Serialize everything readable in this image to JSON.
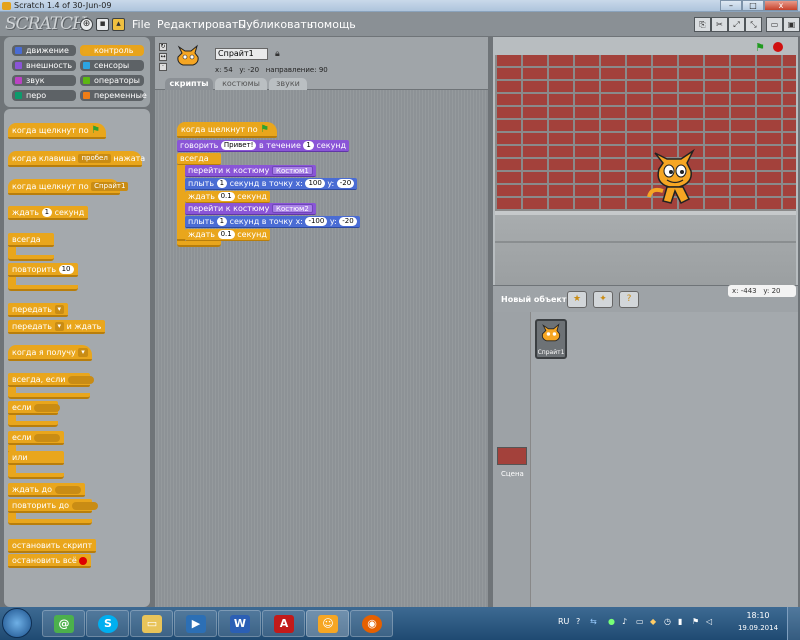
{
  "window": {
    "title": "Scratch 1.4 of 30-Jun-09",
    "minimize": "–",
    "maximize": "□",
    "close": "x"
  },
  "menubar": {
    "logo": "SCRATCH",
    "items": [
      "File",
      "Редактировать",
      "Публиковать",
      "помощь"
    ]
  },
  "categories": [
    {
      "label": "движение",
      "color": "#4a6cd4"
    },
    {
      "label": "контроль",
      "color": "#e9a61c",
      "selected": true
    },
    {
      "label": "внешность",
      "color": "#8a55d7"
    },
    {
      "label": "сенсоры",
      "color": "#2ca5e2"
    },
    {
      "label": "звук",
      "color": "#bb42c3"
    },
    {
      "label": "операторы",
      "color": "#5cb712"
    },
    {
      "label": "перо",
      "color": "#0e9a6c"
    },
    {
      "label": "переменные",
      "color": "#ee7d16"
    }
  ],
  "palette": {
    "when_flag": "когда щелкнут по",
    "when_key": "когда клавиша",
    "key_value": "пробел",
    "pressed": "нажата",
    "when_sprite_clicked": "когда щелкнут по",
    "sprite_value": "Спрайт1",
    "wait": "ждать",
    "wait_value": "1",
    "wait_unit": "секунд",
    "forever": "всегда",
    "repeat": "повторить",
    "repeat_value": "10",
    "broadcast": "передать",
    "broadcast_wait": "передать",
    "and_wait": "и ждать",
    "when_receive": "когда я получу",
    "forever_if": "всегда, если",
    "if": "если",
    "if_else": "если",
    "else": "или",
    "wait_until": "ждать до",
    "repeat_until": "повторить до",
    "stop_script": "остановить скрипт",
    "stop_all": "остановить всё"
  },
  "sprite": {
    "name": "Спрайт1",
    "x_label": "x:",
    "x": "54",
    "y_label": "y:",
    "y": "-20",
    "dir_label": "направление:",
    "dir": "90"
  },
  "tabs": [
    "скрипты",
    "костюмы",
    "звуки"
  ],
  "script": {
    "hat": "когда щелкнут по",
    "say": "говорить",
    "say_text": "Привет!",
    "say_for": "в течение",
    "say_secs": "1",
    "say_unit": "секунд",
    "forever": "всегда",
    "switch1": "перейти к костюму",
    "costume1": "Костюм1",
    "glide1": "плыть",
    "glide1_secs": "1",
    "glide1_mid": "секунд в точку x:",
    "glide1_x": "100",
    "glide1_y_label": "y:",
    "glide1_y": "-20",
    "wait1": "ждать",
    "wait1_val": "0.1",
    "wait1_unit": "секунд",
    "switch2": "перейти к костюму",
    "costume2": "Костюм2",
    "glide2": "плыть",
    "glide2_secs": "1",
    "glide2_mid": "секунд в точку x:",
    "glide2_x": "-100",
    "glide2_y_label": "y:",
    "glide2_y": "-20",
    "wait2": "ждать",
    "wait2_val": "0.1",
    "wait2_unit": "секунд"
  },
  "stage": {
    "mouse_x_label": "x:",
    "mouse_x": "-443",
    "mouse_y_label": "y:",
    "mouse_y": "20"
  },
  "new_sprite": {
    "label": "Новый объект"
  },
  "sprites_list": {
    "sprite_label": "Спрайт1",
    "stage_label": "Сцена"
  },
  "taskbar": {
    "lang": "RU",
    "time": "18:10",
    "date": "19.09.2014"
  }
}
